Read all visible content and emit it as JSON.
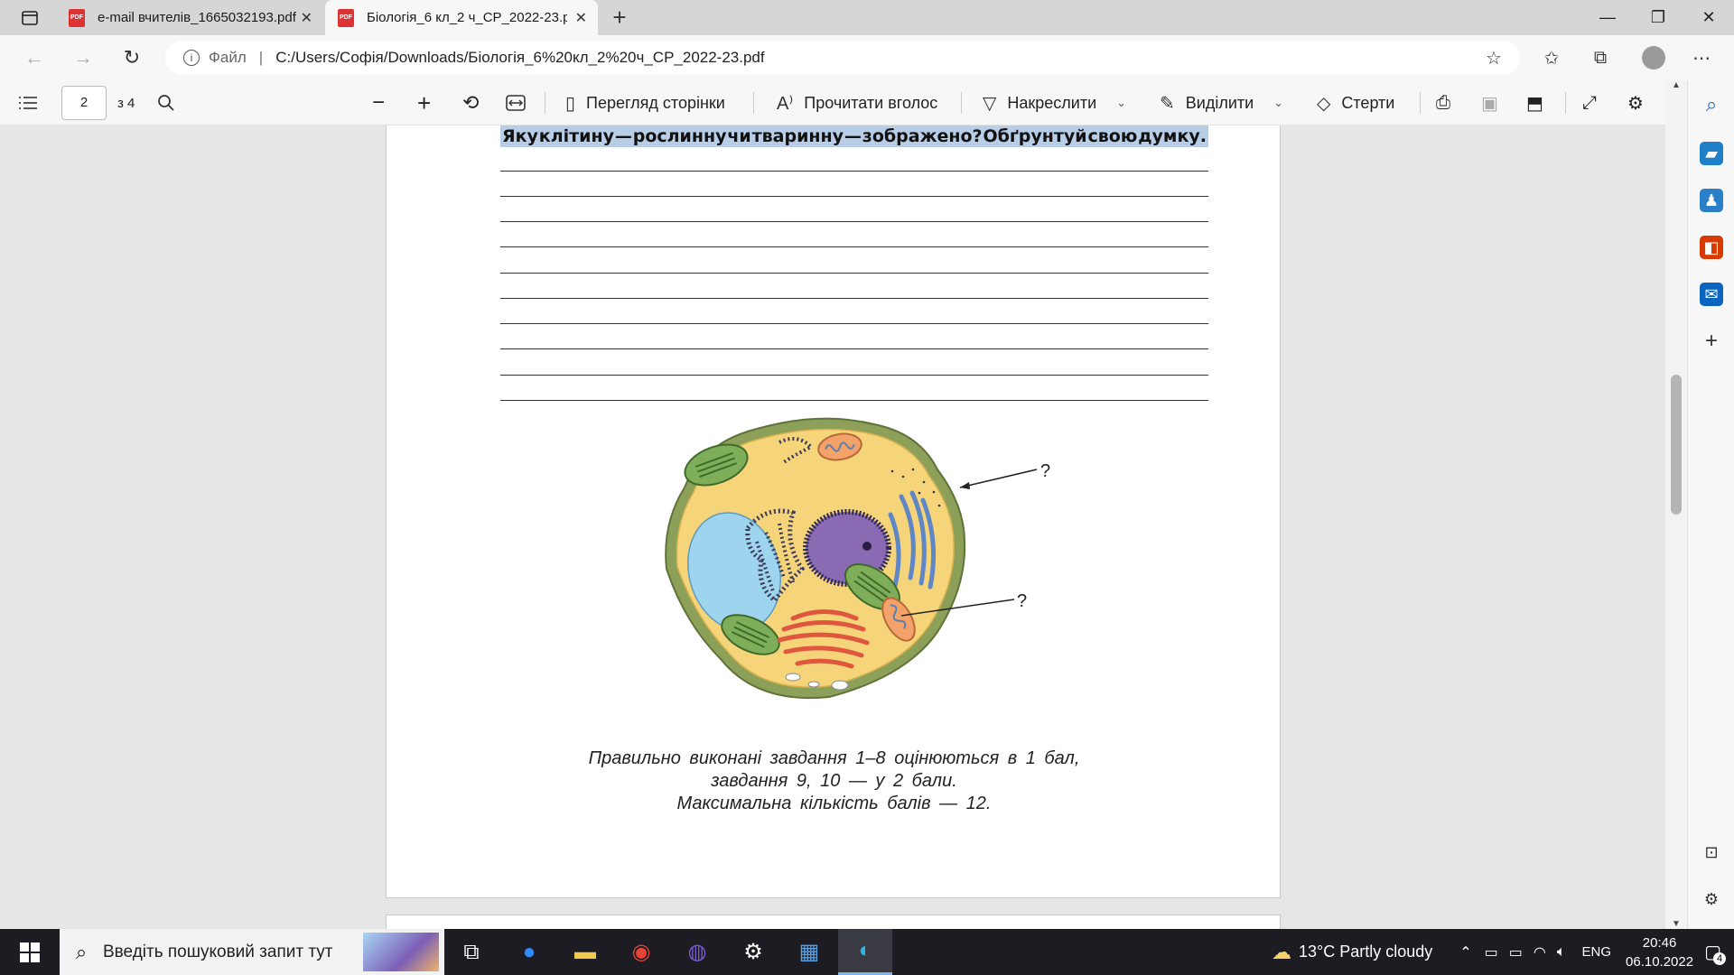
{
  "browser": {
    "tabs": [
      {
        "title": "e-mail вчителів_1665032193.pdf",
        "icon": "pdf-icon",
        "active": false
      },
      {
        "title": "Біологія_6 кл_2 ч_СР_2022-23.pdf",
        "icon": "pdf-icon",
        "active": true
      }
    ],
    "address": {
      "scheme_label": "Файл",
      "separator": "|",
      "url": "C:/Users/Софія/Downloads/Біологія_6%20кл_2%20ч_СР_2022-23.pdf"
    }
  },
  "pdf_toolbar": {
    "page_number": "2",
    "page_total": "з 4",
    "page_view_label": "Перегляд сторінки",
    "read_aloud_label": "Прочитати вголос",
    "draw_label": "Накреслити",
    "highlight_label": "Виділити",
    "erase_label": "Стерти"
  },
  "document": {
    "question": [
      "Яку",
      "клітину",
      "—",
      "рослинну",
      "чи",
      "тваринну",
      "—",
      "зображено?",
      "Обґрунтуй",
      "свою",
      "думку."
    ],
    "cell_labels": [
      "?",
      "?"
    ],
    "footer_lines": [
      "Правильно виконані завдання 1–8 оцінюються в 1 бал,",
      "завдання 9, 10 — у 2 бали.",
      "Максимальна кількість балів — 12."
    ]
  },
  "taskbar": {
    "search_placeholder": "Введіть пошуковий запит тут",
    "weather": "13°C  Partly cloudy",
    "language": "ENG",
    "time": "20:46",
    "date": "06.10.2022",
    "notification_count": "4"
  },
  "colors": {
    "selection": "#b8cde6",
    "cytoplasm": "#f6d47a",
    "cell_wall": "#8da05a",
    "vacuole": "#9fd4ef",
    "nucleus": "#8a6bb3",
    "chloroplast": "#7fae5a",
    "golgi": "#e0573f"
  }
}
